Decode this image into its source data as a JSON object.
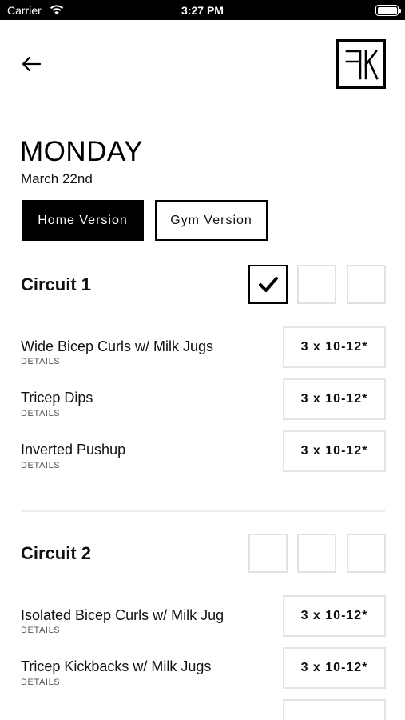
{
  "status_bar": {
    "carrier": "Carrier",
    "time": "3:27 PM",
    "wifi_icon": "wifi-icon",
    "battery_icon": "battery-icon"
  },
  "header": {
    "back_icon": "arrow-left-icon",
    "logo_icon": "fk-logo"
  },
  "workout": {
    "day": "MONDAY",
    "date": "March 22nd"
  },
  "versions": {
    "home_label": "Home Version",
    "gym_label": "Gym Version",
    "selected": "home"
  },
  "circuits": [
    {
      "title": "Circuit 1",
      "sets_checked": [
        true,
        false,
        false
      ],
      "exercises": [
        {
          "name": "Wide Bicep Curls w/ Milk Jugs",
          "details_label": "DETAILS",
          "reps": "3 x 10-12*"
        },
        {
          "name": "Tricep Dips",
          "details_label": "DETAILS",
          "reps": "3 x 10-12*"
        },
        {
          "name": "Inverted Pushup",
          "details_label": "DETAILS",
          "reps": "3 x 10-12*"
        }
      ]
    },
    {
      "title": "Circuit 2",
      "sets_checked": [
        false,
        false,
        false
      ],
      "exercises": [
        {
          "name": "Isolated Bicep Curls w/ Milk Jug",
          "details_label": "DETAILS",
          "reps": "3 x 10-12*"
        },
        {
          "name": "Tricep Kickbacks w/ Milk Jugs",
          "details_label": "DETAILS",
          "reps": "3 x 10-12*"
        }
      ]
    }
  ],
  "colors": {
    "primary": "#000000",
    "background": "#ffffff",
    "box_border": "#e4e4e4"
  }
}
